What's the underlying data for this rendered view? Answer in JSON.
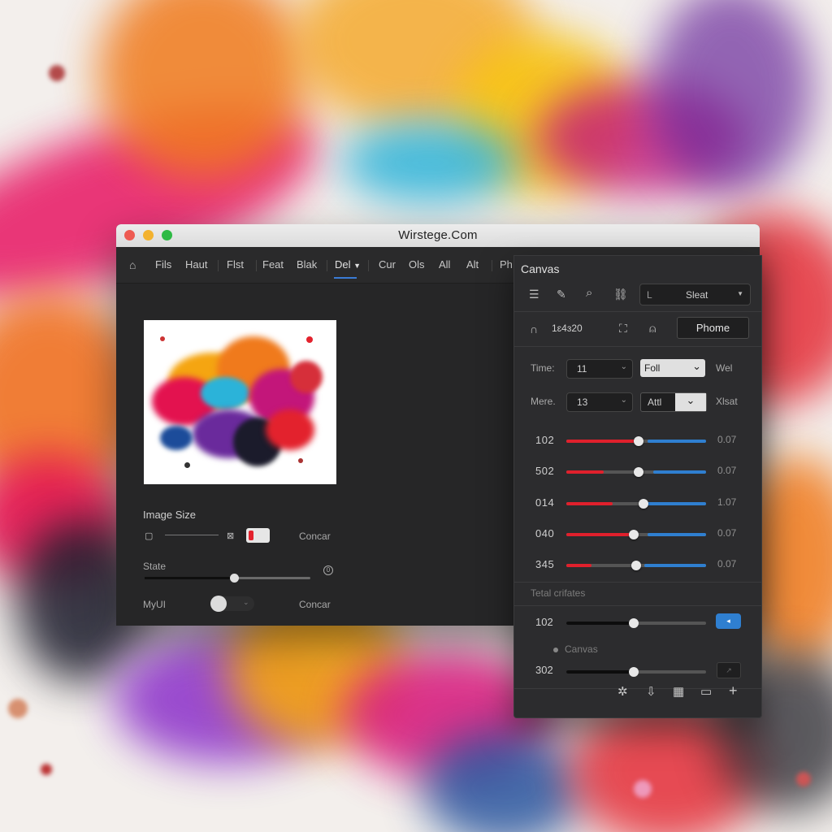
{
  "window": {
    "title": "Wirstege.Com",
    "traffic_lights": [
      "#ee5b52",
      "#f3b22f",
      "#2eba44"
    ]
  },
  "menu": {
    "items": [
      "Fils",
      "Haut",
      "Flst",
      "Feat",
      "Blak",
      "Del",
      "Cur",
      "Ols",
      "All",
      "Alt",
      "Ph"
    ],
    "active": "Del"
  },
  "left": {
    "image_size_label": "Image Size",
    "image_size_action": "Concar",
    "state_label": "State",
    "myui_label": "MyUI",
    "myui_action": "Concar"
  },
  "panel": {
    "title": "Canvas",
    "preset_dropdown": "Sleat",
    "preset_prefix": "L",
    "time_value": "1ɛ4ɜ20",
    "phome_button": "Phome",
    "rows": [
      {
        "label": "Time:",
        "value": "11",
        "select": "Foll",
        "suffix": "Wel"
      },
      {
        "label": "Mere.",
        "value": "13",
        "select": "Attl",
        "suffix": "Xlsat"
      }
    ],
    "sliders": [
      {
        "label": "102",
        "value": 0.52,
        "red": 0.52,
        "blue": 0.42,
        "display": "0.07"
      },
      {
        "label": "502",
        "value": 0.52,
        "red": 0.27,
        "blue": 0.38,
        "display": "0.07"
      },
      {
        "label": "014",
        "value": 0.55,
        "red": 0.33,
        "blue": 0.45,
        "display": "1.07"
      },
      {
        "label": "040",
        "value": 0.48,
        "red": 0.48,
        "blue": 0.42,
        "display": "0.07"
      },
      {
        "label": "345",
        "value": 0.5,
        "red": 0.18,
        "blue": 0.44,
        "display": "0.07"
      }
    ],
    "section_label": "Tetal crifates",
    "bottom_sliders": [
      {
        "label": "102",
        "value": 0.48
      },
      {
        "label": "302",
        "value": 0.48
      }
    ],
    "canvas_label": "Canvas",
    "accent": "#2f7fd0"
  }
}
